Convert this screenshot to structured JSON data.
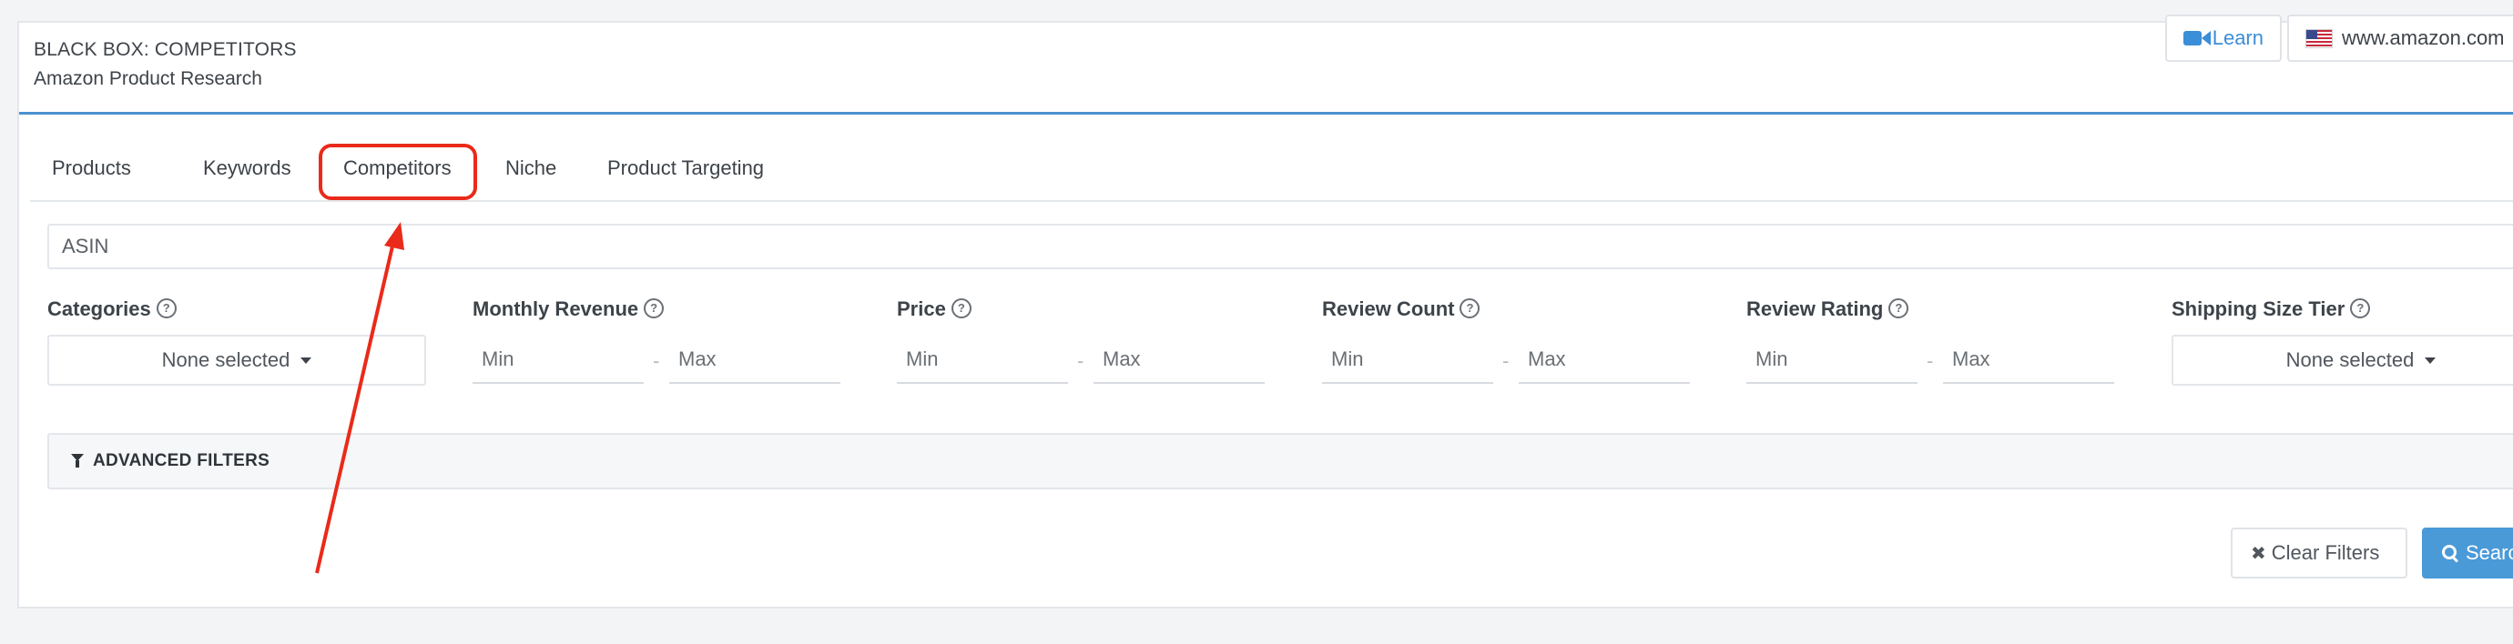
{
  "header": {
    "title": "BLACK BOX: COMPETITORS",
    "subtitle": "Amazon Product Research",
    "learn_label": "Learn",
    "marketplace_label": "www.amazon.com"
  },
  "tabs": [
    {
      "label": "Products"
    },
    {
      "label": "Keywords"
    },
    {
      "label": "Competitors",
      "active": true
    },
    {
      "label": "Niche"
    },
    {
      "label": "Product Targeting"
    }
  ],
  "search": {
    "placeholder": "ASIN"
  },
  "filters": {
    "categories": {
      "label": "Categories",
      "value": "None selected"
    },
    "monthly_revenue": {
      "label": "Monthly Revenue",
      "min_placeholder": "Min",
      "max_placeholder": "Max"
    },
    "price": {
      "label": "Price",
      "min_placeholder": "Min",
      "max_placeholder": "Max"
    },
    "review_count": {
      "label": "Review Count",
      "min_placeholder": "Min",
      "max_placeholder": "Max"
    },
    "review_rating": {
      "label": "Review Rating",
      "min_placeholder": "Min",
      "max_placeholder": "Max"
    },
    "shipping_size_tier": {
      "label": "Shipping Size Tier",
      "value": "None selected"
    },
    "range_separator": "-",
    "help_glyph": "?"
  },
  "advanced_filters_label": "ADVANCED FILTERS",
  "actions": {
    "clear_label": "Clear Filters",
    "search_label": "Search"
  },
  "annotation": {
    "color": "#ea2a1a",
    "highlight": "Competitors tab"
  },
  "icons": {
    "learn": "video-camera-icon",
    "marketplace": "us-flag-icon",
    "help": "question-circle-icon",
    "dropdown": "caret-down-icon",
    "advanced": "filter-icon",
    "clear": "x-icon",
    "search": "magnifier-icon"
  },
  "colors": {
    "accent": "#4a90d0",
    "primary_button": "#4a9ad8",
    "annotation": "#ea2a1a"
  }
}
